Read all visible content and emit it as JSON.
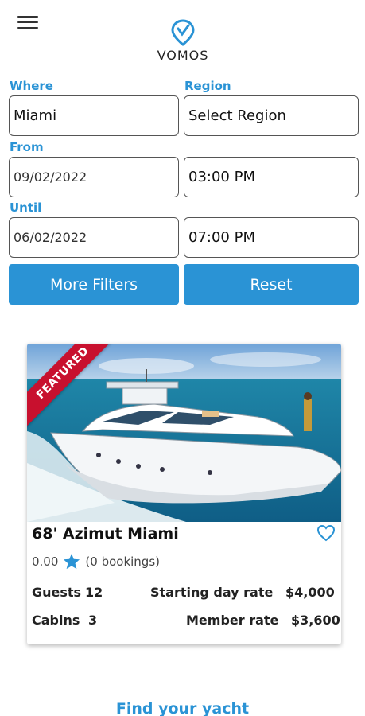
{
  "brand": {
    "name": "VOMOS",
    "accent": "#2a93d5"
  },
  "header": {
    "menu_icon": "hamburger-menu-icon",
    "logo_icon": "location-pin-check-icon"
  },
  "search": {
    "where_label": "Where",
    "where_value": "Miami",
    "region_label": "Region",
    "region_value": "Select Region",
    "from_label": "From",
    "from_date": "09/02/2022",
    "from_time": "03:00 PM",
    "until_label": "Until",
    "until_date": "06/02/2022",
    "until_time": "07:00 PM",
    "more_filters_label": "More Filters",
    "reset_label": "Reset"
  },
  "listing": {
    "badge": "FEATURED",
    "badge_color": "#c8102e",
    "title": "68' Azimut Miami",
    "rating": "0.00",
    "rating_icon": "star-icon",
    "bookings": "(0 bookings)",
    "guests_label": "Guests",
    "guests_value": "12",
    "cabins_label": "Cabins",
    "cabins_value": "3",
    "day_rate_label": "Starting day rate",
    "day_rate_value": "$4,000",
    "member_rate_label": "Member rate",
    "member_rate_value": "$3,600",
    "favorite_icon": "heart-outline-icon"
  },
  "footer": {
    "find_link": "Find your yacht"
  }
}
